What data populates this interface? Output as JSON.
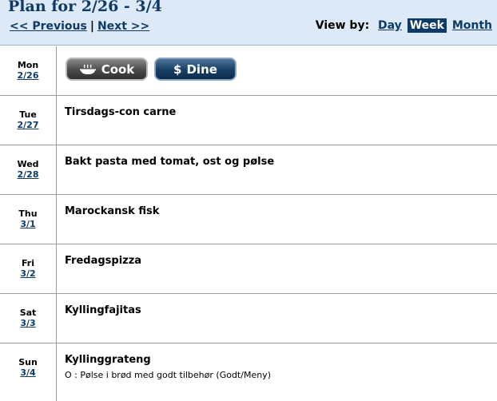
{
  "header": {
    "title": "Plan for 2/26 - 3/4",
    "prev": "<< Previous",
    "separator": "|",
    "next": "Next >>",
    "view_by_label": "View by:",
    "views": [
      "Day",
      "Week",
      "Month"
    ],
    "active_view": "Week"
  },
  "actions": {
    "cook": "Cook",
    "dine": "Dine",
    "dine_symbol": "$"
  },
  "days": [
    {
      "dow": "Mon",
      "date": "2/26",
      "meal": "",
      "note": ""
    },
    {
      "dow": "Tue",
      "date": "2/27",
      "meal": "Tirsdags-con carne",
      "note": ""
    },
    {
      "dow": "Wed",
      "date": "2/28",
      "meal": "Bakt pasta med tomat, ost og pølse",
      "note": ""
    },
    {
      "dow": "Thu",
      "date": "3/1",
      "meal": "Marockansk fisk",
      "note": ""
    },
    {
      "dow": "Fri",
      "date": "3/2",
      "meal": "Fredagspizza",
      "note": ""
    },
    {
      "dow": "Sat",
      "date": "3/3",
      "meal": "Kyllingfajitas",
      "note": ""
    },
    {
      "dow": "Sun",
      "date": "3/4",
      "meal": "Kyllinggrateng",
      "note": "O : Pølse i brød med godt tilbehør (Godt/Meny)"
    }
  ],
  "colors": {
    "header_bg": "#dde9f6",
    "link": "#0d3a66",
    "active_view_bg": "#0d3a66",
    "divider": "#9c9c9c"
  }
}
